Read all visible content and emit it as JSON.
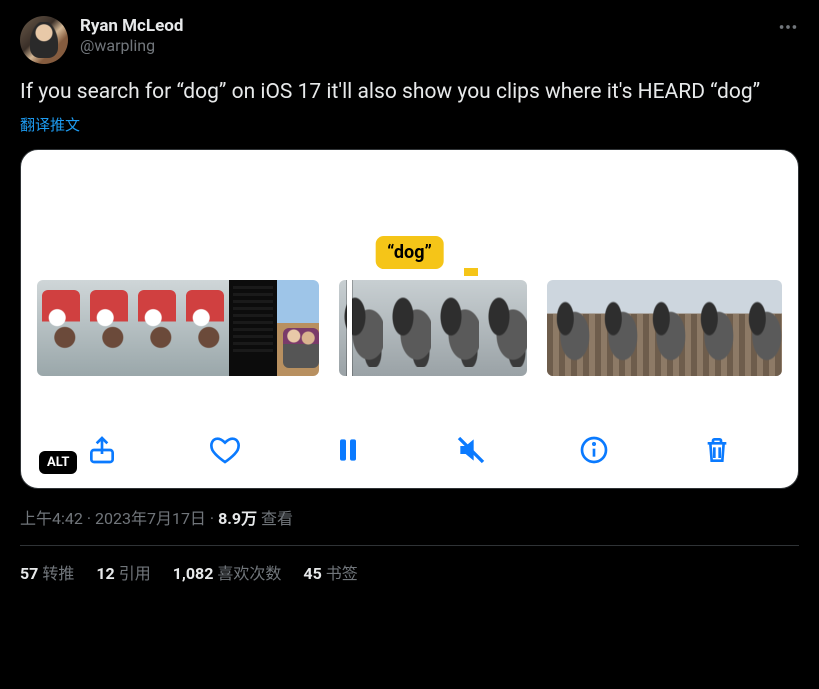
{
  "author": {
    "display_name": "Ryan McLeod",
    "handle": "@warpling"
  },
  "body": "If you search for “dog” on iOS 17 it'll also show you clips where it's HEARD “dog”",
  "translate_label": "翻译推文",
  "media": {
    "badge": "“dog”",
    "alt_label": "ALT",
    "toolbar_icons": {
      "share": "share-icon",
      "like": "heart-icon",
      "pause": "pause-icon",
      "mute": "mute-icon",
      "info": "info-icon",
      "trash": "trash-icon"
    }
  },
  "meta": {
    "time": "上午4:42",
    "sep1": " · ",
    "date": "2023年7月17日",
    "sep2": " · ",
    "views_num": "8.9万",
    "views_label": " 查看"
  },
  "stats": {
    "retweets_num": "57",
    "retweets_label": "转推",
    "quotes_num": "12",
    "quotes_label": "引用",
    "likes_num": "1,082",
    "likes_label": "喜欢次数",
    "bookmarks_num": "45",
    "bookmarks_label": "书签"
  }
}
